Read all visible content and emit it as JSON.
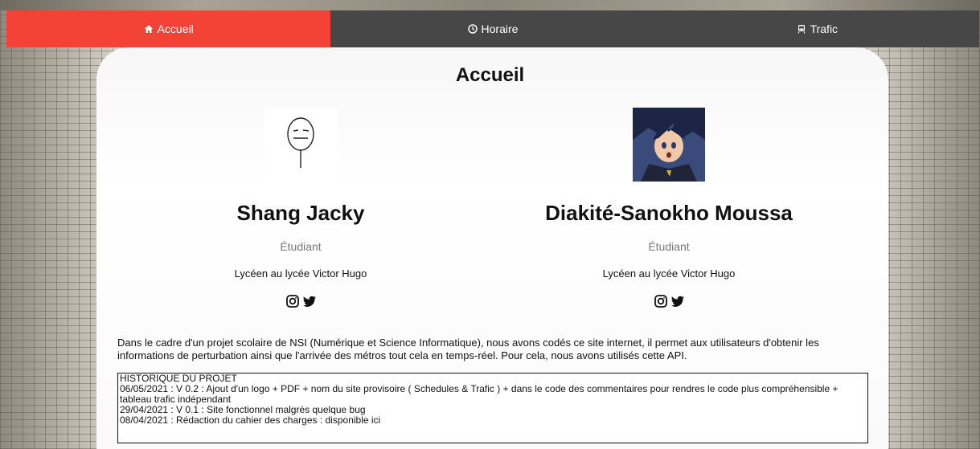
{
  "nav": {
    "items": [
      {
        "label": "Accueil",
        "icon": "home-icon",
        "active": true
      },
      {
        "label": "Horaire",
        "icon": "clock-icon",
        "active": false
      },
      {
        "label": "Trafic",
        "icon": "train-icon",
        "active": false
      }
    ],
    "active_color": "#f44336",
    "bar_color": "#474747"
  },
  "page": {
    "title": "Accueil"
  },
  "members": [
    {
      "name": "Shang Jacky",
      "role": "Étudiant",
      "school": "Lycéen au lycée Victor Hugo",
      "avatar": "poker-face-meme-icon",
      "socials": [
        "instagram-icon",
        "twitter-icon"
      ]
    },
    {
      "name": "Diakité-Sanokho Moussa",
      "role": "Étudiant",
      "school": "Lycéen au lycée Victor Hugo",
      "avatar": "anime-character-icon",
      "socials": [
        "instagram-icon",
        "twitter-icon"
      ]
    }
  ],
  "description": "Dans le cadre d'un projet scolaire de NSI (Numérique et Science Informatique), nous avons codés ce site internet, il permet aux utilisateurs d'obtenir les informations de perturbation ainsi que l'arrivée des métros tout cela en temps-réel. Pour cela, nous avons utilisés cette API.",
  "history": {
    "heading": "HISTORIQUE DU PROJET",
    "entries": [
      "06/05/2021 : V 0.2 : Ajout d'un logo + PDF + nom du site provisoire ( Schedules & Trafic ) + dans le code des commentaires pour rendres le code plus compréhensible + tableau trafic indépendant",
      "29/04/2021 : V 0.1 : Site fonctionnel malgrès quelque bug",
      "08/04/2021 : Rédaction du cahier des charges : disponible ici"
    ]
  }
}
